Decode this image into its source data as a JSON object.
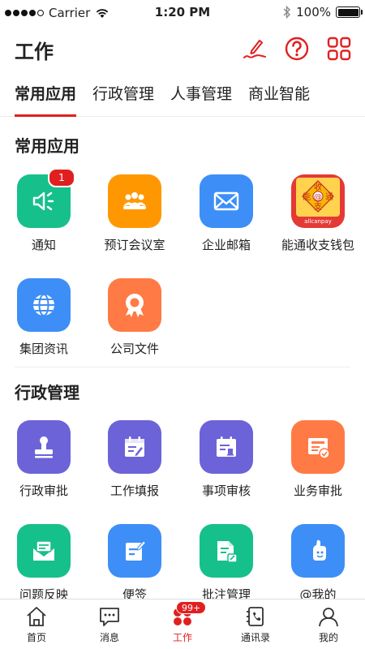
{
  "status_bar": {
    "carrier": "Carrier",
    "time": "1:20 PM",
    "battery": "100%"
  },
  "header": {
    "title": "工作"
  },
  "tabs": [
    {
      "label": "常用应用",
      "active": true
    },
    {
      "label": "行政管理"
    },
    {
      "label": "人事管理"
    },
    {
      "label": "商业智能"
    }
  ],
  "sections": [
    {
      "title": "常用应用",
      "apps": [
        {
          "label": "通知",
          "icon": "speaker-icon",
          "color": "#16C08A",
          "badge": "1"
        },
        {
          "label": "预订会议室",
          "icon": "people-icon",
          "color": "#FF9800"
        },
        {
          "label": "企业邮箱",
          "icon": "mail-icon",
          "color": "#3E8EF7"
        },
        {
          "label": "能通收支钱包",
          "icon": "wallet-logo",
          "color": "#E53935",
          "logo": {
            "top": "收",
            "left": "能",
            "center": "@",
            "right": "通",
            "bottom": "支",
            "text": "allcanpay"
          }
        },
        {
          "label": "集团资讯",
          "icon": "globe-icon",
          "color": "#3E8EF7"
        },
        {
          "label": "公司文件",
          "icon": "award-icon",
          "color": "#FF7A45"
        }
      ]
    },
    {
      "title": "行政管理",
      "apps": [
        {
          "label": "行政审批",
          "icon": "stamp-icon",
          "color": "#6C63D9"
        },
        {
          "label": "工作填报",
          "icon": "calendar-edit-icon",
          "color": "#6C63D9"
        },
        {
          "label": "事项审核",
          "icon": "calendar-check-icon",
          "color": "#6C63D9"
        },
        {
          "label": "业务审批",
          "icon": "approval-icon",
          "color": "#FF7A45"
        },
        {
          "label": "问题反映",
          "icon": "feedback-mail-icon",
          "color": "#16C08A"
        },
        {
          "label": "便签",
          "icon": "note-icon",
          "color": "#3E8EF7"
        },
        {
          "label": "批注管理",
          "icon": "doc-annotate-icon",
          "color": "#16C08A"
        },
        {
          "label": "@我的",
          "icon": "thumb-icon",
          "color": "#3E8EF7"
        }
      ]
    }
  ],
  "tabbar": [
    {
      "label": "首页",
      "icon": "home-icon"
    },
    {
      "label": "消息",
      "icon": "message-icon"
    },
    {
      "label": "工作",
      "icon": "work-icon",
      "active": true,
      "badge": "99+"
    },
    {
      "label": "通讯录",
      "icon": "contacts-icon"
    },
    {
      "label": "我的",
      "icon": "profile-icon"
    }
  ],
  "colors": {
    "accent": "#E02020",
    "text": "#222222",
    "divider": "#EEEEEE"
  }
}
